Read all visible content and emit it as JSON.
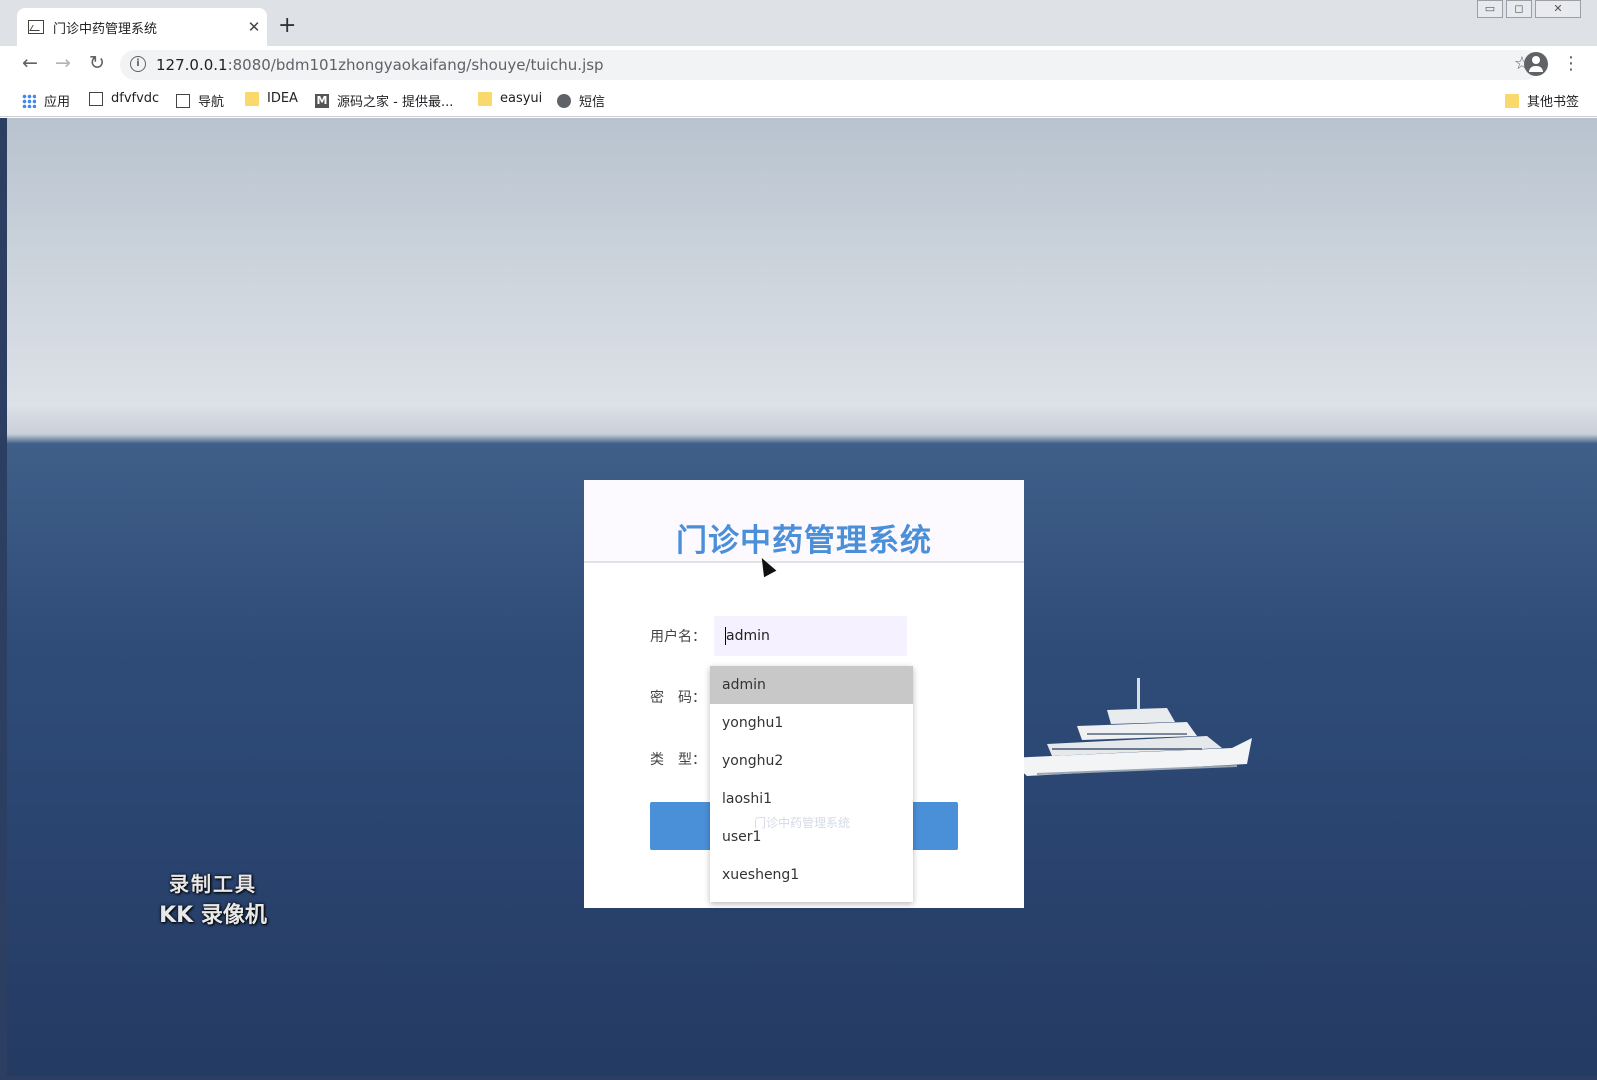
{
  "browser": {
    "tab_title": "门诊中药管理系统",
    "tab_close": "✕",
    "new_tab": "+",
    "window_controls": {
      "minimize": "▭",
      "restore": "◻",
      "close": "✕"
    },
    "nav": {
      "back": "←",
      "forward": "→",
      "reload": "↻"
    },
    "url_host": "127.0.0.1",
    "url_rest": ":8080/bdm101zhongyaokaifang/shouye/tuichu.jsp",
    "bookmark_star": "☆",
    "menu": "⋮",
    "bookmarks": [
      {
        "label": "应用",
        "icon": "apps-icon"
      },
      {
        "label": "dfvfvdc",
        "icon": "image-icon"
      },
      {
        "label": "导航",
        "icon": "image-icon"
      },
      {
        "label": "IDEA",
        "icon": "folder-icon"
      },
      {
        "label": "源码之家 - 提供最...",
        "icon": "m-icon"
      },
      {
        "label": "easyui",
        "icon": "folder-icon"
      },
      {
        "label": "短信",
        "icon": "globe-icon"
      }
    ],
    "other_bookmarks": "其他书签"
  },
  "login": {
    "title": "门诊中药管理系统",
    "username_label": "用户名：",
    "username_value": "admin",
    "password_label": "密　码：",
    "type_label": "类　型："
  },
  "autocomplete": {
    "options": [
      "admin",
      "yonghu1",
      "yonghu2",
      "laoshi1",
      "user1",
      "xuesheng1"
    ],
    "selected_index": 0
  },
  "footer": "门诊中药管理系统",
  "watermark": {
    "line1": "录制工具",
    "line2": "KK 录像机"
  }
}
